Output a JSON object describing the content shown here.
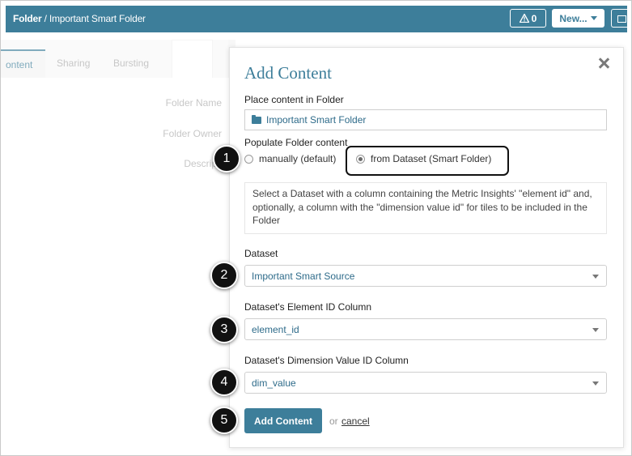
{
  "header": {
    "breadcrumb_root": "Folder",
    "breadcrumb_sep": " / ",
    "breadcrumb_current": "Important Smart Folder",
    "alert_count": "0",
    "new_label": "New..."
  },
  "tabs": [
    {
      "label": "ontent"
    },
    {
      "label": "Sharing"
    },
    {
      "label": "Bursting"
    }
  ],
  "background_form": {
    "folder_name_label": "Folder Name",
    "folder_owner_label": "Folder Owner",
    "description_label": "Descripti"
  },
  "modal": {
    "title": "Add Content",
    "place_label": "Place content in Folder",
    "folder_value": "Important Smart Folder",
    "populate_label": "Populate Folder content",
    "radio_manual": "manually (default)",
    "radio_dataset": "from Dataset (Smart Folder)",
    "info_text": "Select a Dataset with a column containing the Metric Insights' \"element id\" and, optionally, a column with the \"dimension value id\" for tiles to be included in the Folder",
    "dataset_label": "Dataset",
    "dataset_value": "Important Smart Source",
    "element_label": "Dataset's Element ID Column",
    "element_value": "element_id",
    "dim_label": "Dataset's Dimension Value ID Column",
    "dim_value": "dim_value",
    "add_button": "Add Content",
    "or_text": "or",
    "cancel_link": "cancel"
  },
  "callouts": [
    "1",
    "2",
    "3",
    "4",
    "5"
  ],
  "colors": {
    "accent": "#3d7e9a",
    "callout": "#111111"
  }
}
